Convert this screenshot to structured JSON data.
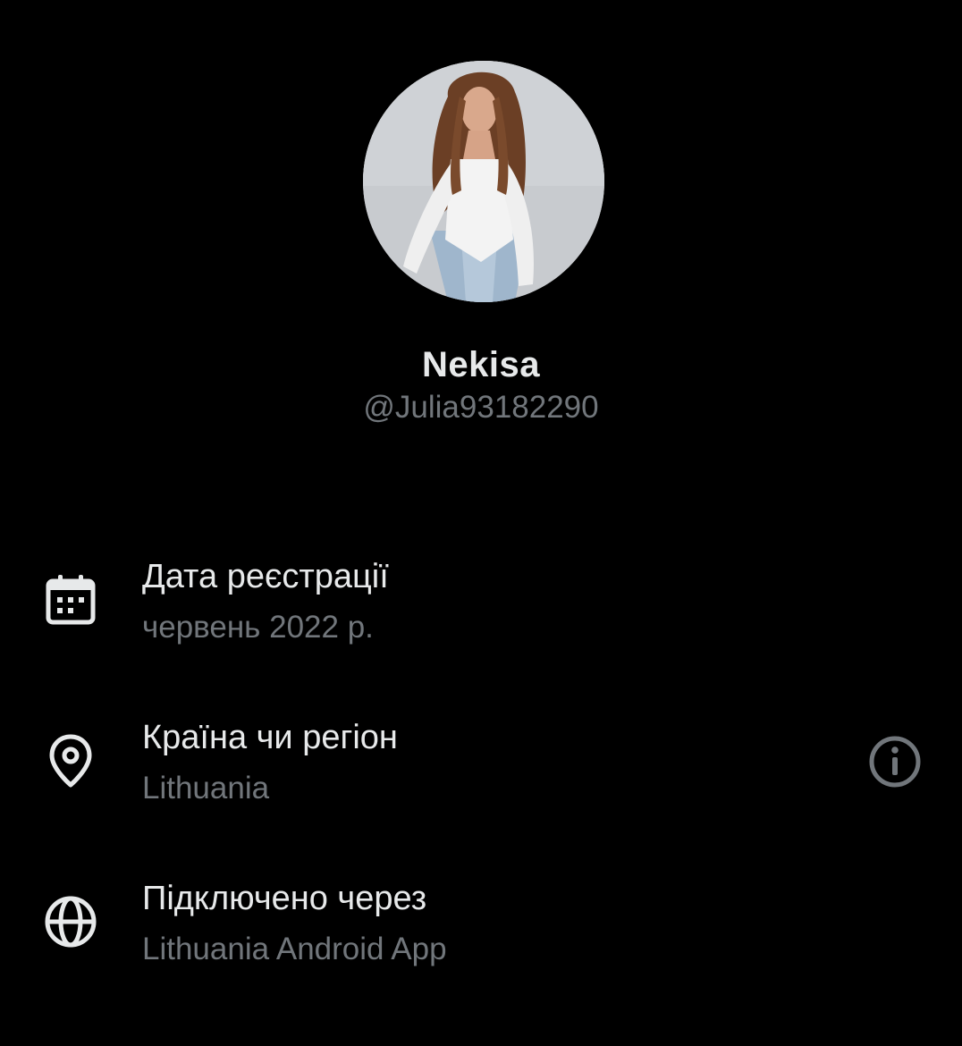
{
  "profile": {
    "display_name": "Nekisa",
    "handle": "@Julia93182290"
  },
  "about": {
    "items": [
      {
        "icon": "calendar-icon",
        "label": "Дата реєстрації",
        "value": "червень 2022 р."
      },
      {
        "icon": "location-pin-icon",
        "label": "Країна чи регіон",
        "value": "Lithuania",
        "action_icon": "info-icon"
      },
      {
        "icon": "globe-icon",
        "label": "Підключено через",
        "value": "Lithuania Android App"
      }
    ]
  },
  "colors": {
    "background": "#000000",
    "primary_text": "#e7e9ea",
    "secondary_text": "#71767b"
  }
}
